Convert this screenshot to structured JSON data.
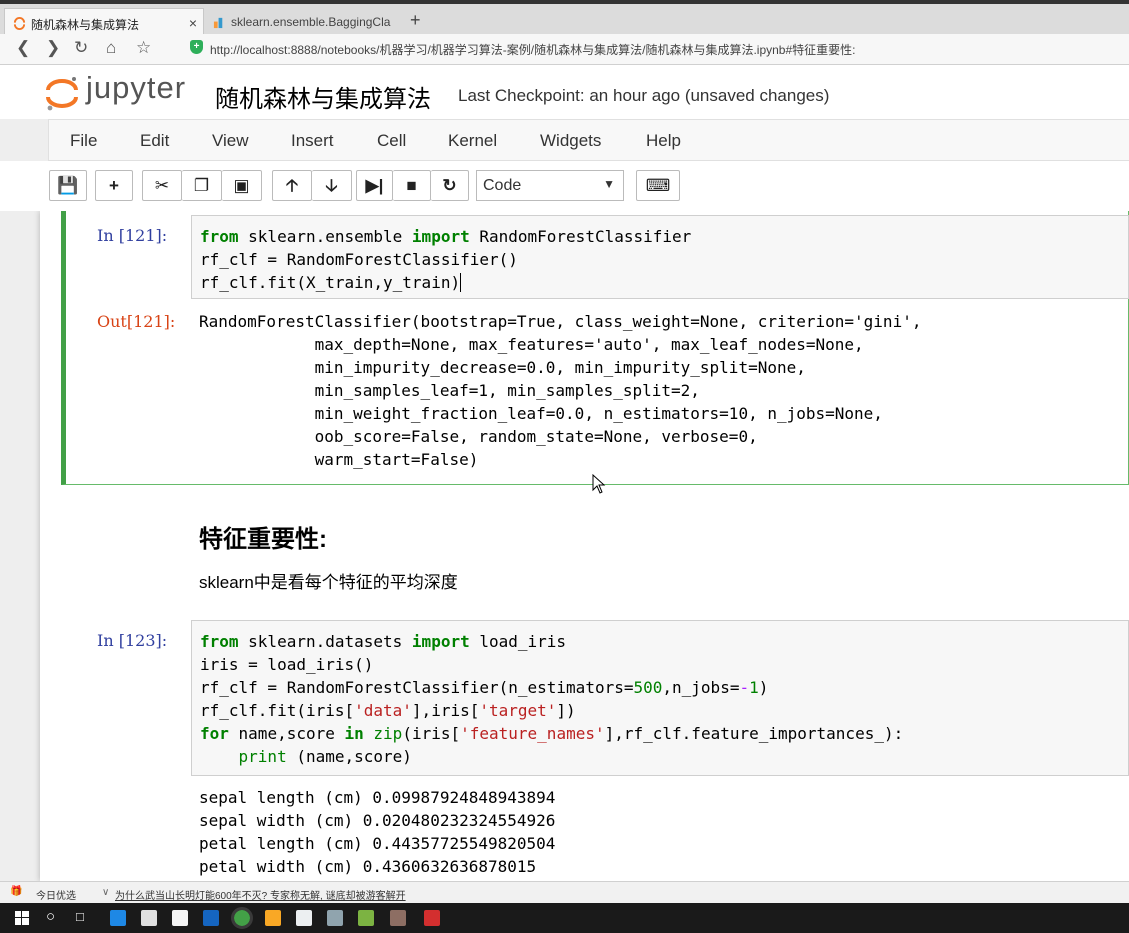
{
  "browser": {
    "tabs": [
      {
        "title": "随机森林与集成算法",
        "active": true
      },
      {
        "title": "sklearn.ensemble.BaggingCla",
        "active": false
      }
    ],
    "url": "http://localhost:8888/notebooks/机器学习/机器学习算法-案例/随机森林与集成算法/随机森林与集成算法.ipynb#特征重要性:"
  },
  "jupyter": {
    "logo": "jupyter",
    "notebook_title": "随机森林与集成算法",
    "checkpoint": "Last Checkpoint: an hour ago (unsaved changes)",
    "menu": [
      "File",
      "Edit",
      "View",
      "Insert",
      "Cell",
      "Kernel",
      "Widgets",
      "Help"
    ],
    "cell_type": "Code"
  },
  "cells": {
    "c121": {
      "in_prompt": "In [121]:",
      "out_prompt": "Out[121]:",
      "output_lines": [
        "RandomForestClassifier(bootstrap=True, class_weight=None, criterion='gini',",
        "            max_depth=None, max_features='auto', max_leaf_nodes=None,",
        "            min_impurity_decrease=0.0, min_impurity_split=None,",
        "            min_samples_leaf=1, min_samples_split=2,",
        "            min_weight_fraction_leaf=0.0, n_estimators=10, n_jobs=None,",
        "            oob_score=False, random_state=None, verbose=0,",
        "            warm_start=False)"
      ]
    },
    "markdown": {
      "heading": "特征重要性:",
      "text": "sklearn中是看每个特征的平均深度"
    },
    "c123": {
      "in_prompt": "In [123]:",
      "output_lines": [
        "sepal length (cm) 0.09987924848943894",
        "sepal width (cm) 0.020480232324554926",
        "petal length (cm) 0.44357725549820504",
        "petal width (cm) 0.4360632636878015"
      ]
    }
  },
  "statusbar": {
    "left": "今日优选",
    "news": "为什么武当山长明灯能600年不灭? 专家称无解, 谜底却被游客解开"
  }
}
